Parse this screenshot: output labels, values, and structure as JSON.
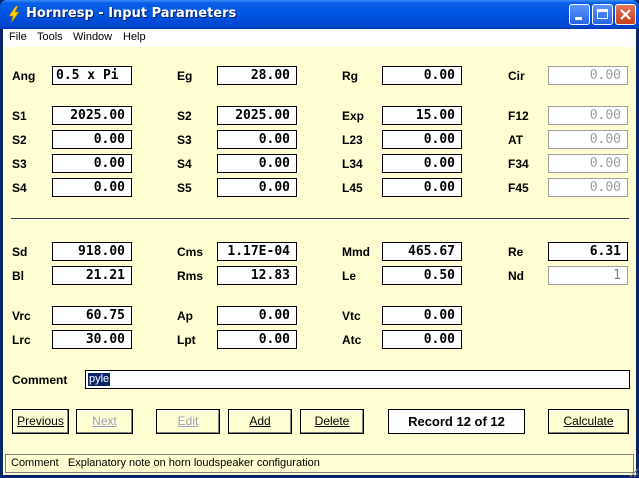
{
  "window": {
    "title": "Hornresp - Input Parameters"
  },
  "menu": [
    "File",
    "Tools",
    "Window",
    "Help"
  ],
  "params": {
    "Ang": "0.5 x Pi",
    "Eg": "28.00",
    "Rg": "0.00",
    "Cir": "0.00",
    "S1": "2025.00",
    "S2": "2025.00",
    "Exp": "15.00",
    "F12": "0.00",
    "S2b": "0.00",
    "S3": "0.00",
    "L23": "0.00",
    "AT": "0.00",
    "S3b": "0.00",
    "S4": "0.00",
    "L34": "0.00",
    "F34": "0.00",
    "S4b": "0.00",
    "S5": "0.00",
    "L45": "0.00",
    "F45": "0.00",
    "Sd": "918.00",
    "Cms": "1.17E-04",
    "Mmd": "465.67",
    "Re": "6.31",
    "Bl": "21.21",
    "Rms": "12.83",
    "Le": "0.50",
    "Nd": "1",
    "Vrc": "60.75",
    "Ap": "0.00",
    "Vtc": "0.00",
    "Lrc": "30.00",
    "Lpt": "0.00",
    "Atc": "0.00"
  },
  "labels": {
    "Ang": "Ang",
    "Eg": "Eg",
    "Rg": "Rg",
    "Cir": "Cir",
    "S1": "S1",
    "S2": "S2",
    "Exp": "Exp",
    "F12": "F12",
    "S2b": "S2",
    "S3": "S3",
    "L23": "L23",
    "AT": "AT",
    "S3b": "S3",
    "S4": "S4",
    "L34": "L34",
    "F34": "F34",
    "S4b": "S4",
    "S5": "S5",
    "L45": "L45",
    "F45": "F45",
    "Sd": "Sd",
    "Cms": "Cms",
    "Mmd": "Mmd",
    "Re": "Re",
    "Bl": "Bl",
    "Rms": "Rms",
    "Le": "Le",
    "Nd": "Nd",
    "Vrc": "Vrc",
    "Ap": "Ap",
    "Vtc": "Vtc",
    "Lrc": "Lrc",
    "Lpt": "Lpt",
    "Atc": "Atc"
  },
  "comment": {
    "label": "Comment",
    "value": "pyle"
  },
  "buttons": {
    "previous": "Previous",
    "next": "Next",
    "edit": "Edit",
    "add": "Add",
    "delete": "Delete",
    "calculate": "Calculate"
  },
  "record": "Record 12 of 12",
  "status": {
    "field": "Comment",
    "text": "Explanatory note on horn loudspeaker configuration"
  },
  "colors": {
    "client_bg": "#fffdd2",
    "titlebar": "#0054e3",
    "selection": "#0a246a"
  },
  "icons": {
    "app": "lightning-icon",
    "minimize": "minimize-icon",
    "maximize": "maximize-icon",
    "close": "close-icon"
  }
}
